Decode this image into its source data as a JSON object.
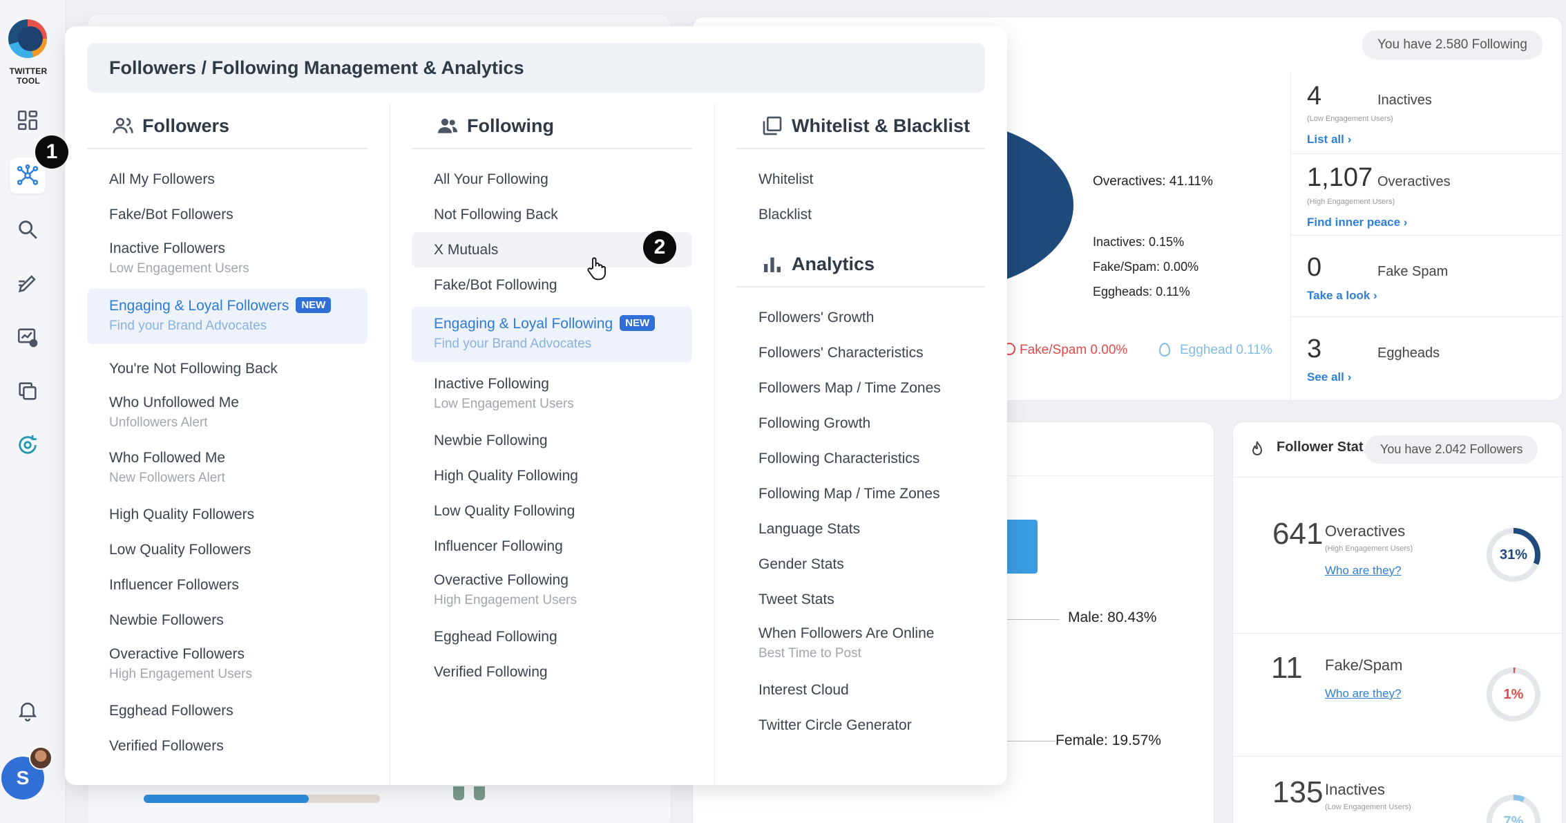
{
  "app": {
    "logo_text": "TWITTER TOOL",
    "avatar_letter": "S"
  },
  "badges": {
    "one": "1",
    "two": "2"
  },
  "background": {
    "following_pill": "You have 2.580 Following",
    "followers_pill": "You have 2.042 Followers",
    "follower_stats_title": "Follower Stat",
    "pie_labels": {
      "overactives": "Overactives: 41.11%",
      "inactives": "Inactives: 0.15%",
      "fake_spam": "Fake/Spam: 0.00%",
      "eggheads": "Eggheads: 0.11%"
    },
    "legend": {
      "fake_spam": "Fake/Spam 0.00%",
      "egghead": "Egghead 0.11%"
    },
    "gender": {
      "male": "Male: 80.43%",
      "female": "Female: 19.57%"
    },
    "following_stats": [
      {
        "value": "4",
        "label": "Inactives",
        "sub": "(Low Engagement Users)",
        "link": "List all ›"
      },
      {
        "value": "1,107",
        "label": "Overactives",
        "sub": "(High Engagement Users)",
        "link": "Find inner peace ›"
      },
      {
        "value": "0",
        "label": "Fake Spam",
        "sub": "",
        "link": "Take a look ›"
      },
      {
        "value": "3",
        "label": "Eggheads",
        "sub": "",
        "link": "See all ›"
      }
    ],
    "follower_stats": [
      {
        "value": "641",
        "label": "Overactives",
        "sub": "(High Engagement Users)",
        "link": "Who are they?",
        "pct": "31%"
      },
      {
        "value": "11",
        "label": "Fake/Spam",
        "sub": "",
        "link": "Who are they?",
        "pct": "1%"
      },
      {
        "value": "135",
        "label": "Inactives",
        "sub": "(Low Engagement Users)",
        "link": "",
        "pct": "7%"
      }
    ],
    "colors": {
      "pie_dark": "#1f4a7c",
      "pie_light": "#8cc3e6",
      "arrow": "#3b9be0",
      "progress": "#2a8ad8",
      "red": "#e24b4b"
    }
  },
  "menu": {
    "title": "Followers / Following Management & Analytics",
    "followers": {
      "heading": "Followers",
      "items": [
        {
          "label": "All My Followers"
        },
        {
          "label": "Fake/Bot Followers"
        },
        {
          "label": "Inactive Followers",
          "sub": "Low Engagement Users"
        },
        {
          "label": "Engaging & Loyal Followers",
          "sub": "Find your Brand Advocates",
          "badge": "NEW"
        },
        {
          "label": "You're Not Following Back"
        },
        {
          "label": "Who Unfollowed Me",
          "sub": "Unfollowers Alert"
        },
        {
          "label": "Who Followed Me",
          "sub": "New Followers Alert"
        },
        {
          "label": "High Quality Followers"
        },
        {
          "label": "Low Quality Followers"
        },
        {
          "label": "Influencer Followers"
        },
        {
          "label": "Newbie Followers"
        },
        {
          "label": "Overactive Followers",
          "sub": "High Engagement Users"
        },
        {
          "label": "Egghead Followers"
        },
        {
          "label": "Verified Followers"
        }
      ]
    },
    "following": {
      "heading": "Following",
      "items": [
        {
          "label": "All Your Following"
        },
        {
          "label": "Not Following Back"
        },
        {
          "label": "X Mutuals"
        },
        {
          "label": "Fake/Bot Following"
        },
        {
          "label": "Engaging & Loyal Following",
          "sub": "Find your Brand Advocates",
          "badge": "NEW"
        },
        {
          "label": "Inactive Following",
          "sub": "Low Engagement Users"
        },
        {
          "label": "Newbie Following"
        },
        {
          "label": "High Quality Following"
        },
        {
          "label": "Low Quality Following"
        },
        {
          "label": "Influencer Following"
        },
        {
          "label": "Overactive Following",
          "sub": "High Engagement Users"
        },
        {
          "label": "Egghead Following"
        },
        {
          "label": "Verified Following"
        }
      ]
    },
    "whitelist": {
      "heading": "Whitelist & Blacklist",
      "items": [
        {
          "label": "Whitelist"
        },
        {
          "label": "Blacklist"
        }
      ]
    },
    "analytics": {
      "heading": "Analytics",
      "items": [
        {
          "label": "Followers' Growth"
        },
        {
          "label": "Followers' Characteristics"
        },
        {
          "label": "Followers Map / Time Zones"
        },
        {
          "label": "Following Growth"
        },
        {
          "label": "Following Characteristics"
        },
        {
          "label": "Following Map / Time Zones"
        },
        {
          "label": "Language Stats"
        },
        {
          "label": "Gender Stats"
        },
        {
          "label": "Tweet Stats"
        },
        {
          "label": "When Followers Are Online",
          "sub": "Best Time to Post"
        },
        {
          "label": "Interest Cloud"
        },
        {
          "label": "Twitter Circle Generator"
        }
      ]
    }
  }
}
